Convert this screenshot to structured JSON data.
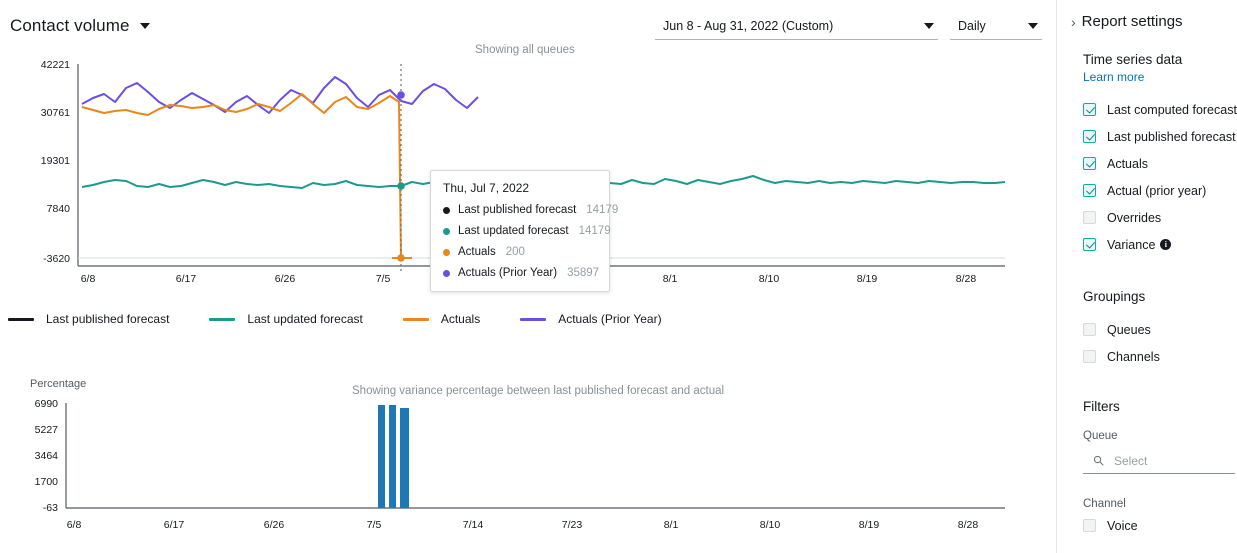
{
  "header": {
    "title": "Contact volume",
    "title_caret": "chevron-down-icon",
    "date_range": "Jun 8 - Aug 31, 2022 (Custom)",
    "interval": "Daily"
  },
  "main": {
    "showing_queues": "Showing all queues",
    "showing_variance": "Showing variance percentage between last published forecast and actual",
    "percentage_axis_title": "Percentage"
  },
  "legend": [
    {
      "label": "Last published forecast",
      "color": "#16191f"
    },
    {
      "label": "Last updated forecast",
      "color": "#1d9a8f"
    },
    {
      "label": "Actuals",
      "color": "#e8871a"
    },
    {
      "label": "Actuals (Prior Year)",
      "color": "#6b4ee6"
    }
  ],
  "tooltip": {
    "date": "Thu, Jul 7, 2022",
    "rows": [
      {
        "label": "Last published forecast",
        "value": "14179",
        "color": "#16191f"
      },
      {
        "label": "Last updated forecast",
        "value": "14179",
        "color": "#1d9a8f"
      },
      {
        "label": "Actuals",
        "value": "200",
        "color": "#e8871a"
      },
      {
        "label": "Actuals (Prior Year)",
        "value": "35897",
        "color": "#6b4ee6"
      }
    ]
  },
  "sidebar": {
    "header": {
      "chevron": "chevron-right-icon",
      "title": "Report settings"
    },
    "time_series": {
      "title": "Time series data",
      "learn_more": "Learn more",
      "items": [
        {
          "label": "Last computed forecast",
          "checked": true
        },
        {
          "label": "Last published forecast",
          "checked": true
        },
        {
          "label": "Actuals",
          "checked": true
        },
        {
          "label": "Actual (prior year)",
          "checked": true
        },
        {
          "label": "Overrides",
          "checked": false
        },
        {
          "label": "Variance",
          "checked": true,
          "info": true
        }
      ]
    },
    "groupings": {
      "title": "Groupings",
      "items": [
        {
          "label": "Queues",
          "checked": false
        },
        {
          "label": "Channels",
          "checked": false
        }
      ]
    },
    "filters": {
      "title": "Filters",
      "queue_label": "Queue",
      "queue_placeholder": "Select",
      "channel_label": "Channel",
      "channel_items": [
        {
          "label": "Voice",
          "checked": false
        }
      ]
    }
  },
  "chart_data": [
    {
      "type": "line",
      "id": "contact-volume",
      "title": "Contact volume",
      "subtitle": "Showing all queues",
      "xlabel": "",
      "ylabel": "",
      "ylim": [
        -3620,
        42221
      ],
      "yticks": [
        42221,
        30761,
        19301,
        7840,
        -3620
      ],
      "xticks": [
        "6/8",
        "6/17",
        "6/26",
        "7/5",
        "7/14",
        "7/23",
        "8/1",
        "8/10",
        "8/19",
        "8/28"
      ],
      "grid": false,
      "legend_position": "bottom",
      "highlight_x": "7/5",
      "highlight_label": "Thu, Jul 7, 2022",
      "series": [
        {
          "name": "Last published forecast",
          "color": "#16191f",
          "values": []
        },
        {
          "name": "Last updated forecast",
          "color": "#1d9a8f",
          "values": [
            14050,
            14180,
            14420,
            14600,
            14500,
            14150,
            14120,
            14280,
            14100,
            14140,
            14350,
            14620,
            14400,
            14200,
            14430,
            14300,
            14180,
            14250,
            14120,
            14000,
            13950,
            14320,
            14150,
            14280,
            14500,
            14200,
            14150,
            14060,
            14179,
            14179,
            14550,
            14320,
            14480,
            14700,
            14350,
            14200,
            14500,
            14300,
            14680,
            14450,
            14280,
            14550,
            14700,
            14380,
            14600,
            14300,
            14500,
            14750,
            14420,
            14300,
            14600,
            14400,
            14350,
            14700,
            14520,
            14300,
            14600,
            14450,
            14300,
            14550,
            14700,
            14900,
            14600,
            14400,
            14550,
            14450,
            14380,
            14520,
            14400,
            14450,
            14380,
            14500,
            14420,
            14350,
            14480,
            14400,
            14380,
            14450,
            14400,
            14350,
            14420,
            14400,
            14380,
            14350,
            14400
          ]
        },
        {
          "name": "Actuals",
          "color": "#e8871a",
          "values": [
            34800,
            34200,
            33500,
            33900,
            34100,
            33400,
            32900,
            34400,
            35200,
            35100,
            34600,
            34800,
            35300,
            34200,
            33600,
            34400,
            35600,
            34900,
            33800,
            35800,
            38200,
            35600,
            33400,
            36200,
            37400,
            35100,
            34700,
            36000,
            37900,
            36300,
            34900,
            35500,
            36700,
            35200,
            33900,
            34600,
            35900,
            36800,
            35400,
            34200,
            35600,
            37400,
            36900,
            35800,
            38100,
            200
          ]
        },
        {
          "name": "Actuals (Prior Year)",
          "color": "#6b4ee6",
          "values": [
            34600,
            35400,
            35900,
            34800,
            36800,
            37400,
            36200,
            34900,
            34100,
            35200,
            36100,
            35400,
            34600,
            33800,
            34900,
            35600,
            34500,
            33700,
            35200,
            36400,
            35800,
            34700,
            36700,
            38100,
            37200,
            35400,
            34300,
            35900,
            36600,
            35200,
            34800,
            36300,
            37100,
            36500,
            35100,
            34200,
            35600,
            36900,
            37800,
            36200,
            35400,
            34700,
            36100,
            37300,
            36800,
            35897,
            35400,
            36200,
            36100,
            35900,
            36400,
            38600,
            36700,
            35200,
            36400,
            35800
          ]
        }
      ]
    },
    {
      "type": "bar",
      "id": "variance-percentage",
      "title": "Showing variance percentage between last published forecast and actual",
      "ylabel": "Percentage",
      "ylim": [
        -63,
        6990
      ],
      "yticks": [
        6990,
        5227,
        3464,
        1700,
        -63
      ],
      "xticks": [
        "6/8",
        "6/17",
        "6/26",
        "7/5",
        "7/14",
        "7/23",
        "8/1",
        "8/10",
        "8/19",
        "8/28"
      ],
      "grid": false,
      "bar_color": "#1f77b4",
      "bars": [
        {
          "x": "7/7",
          "value": 6990
        },
        {
          "x": "7/8",
          "value": 6990
        },
        {
          "x": "7/9",
          "value": 6840
        }
      ]
    }
  ]
}
